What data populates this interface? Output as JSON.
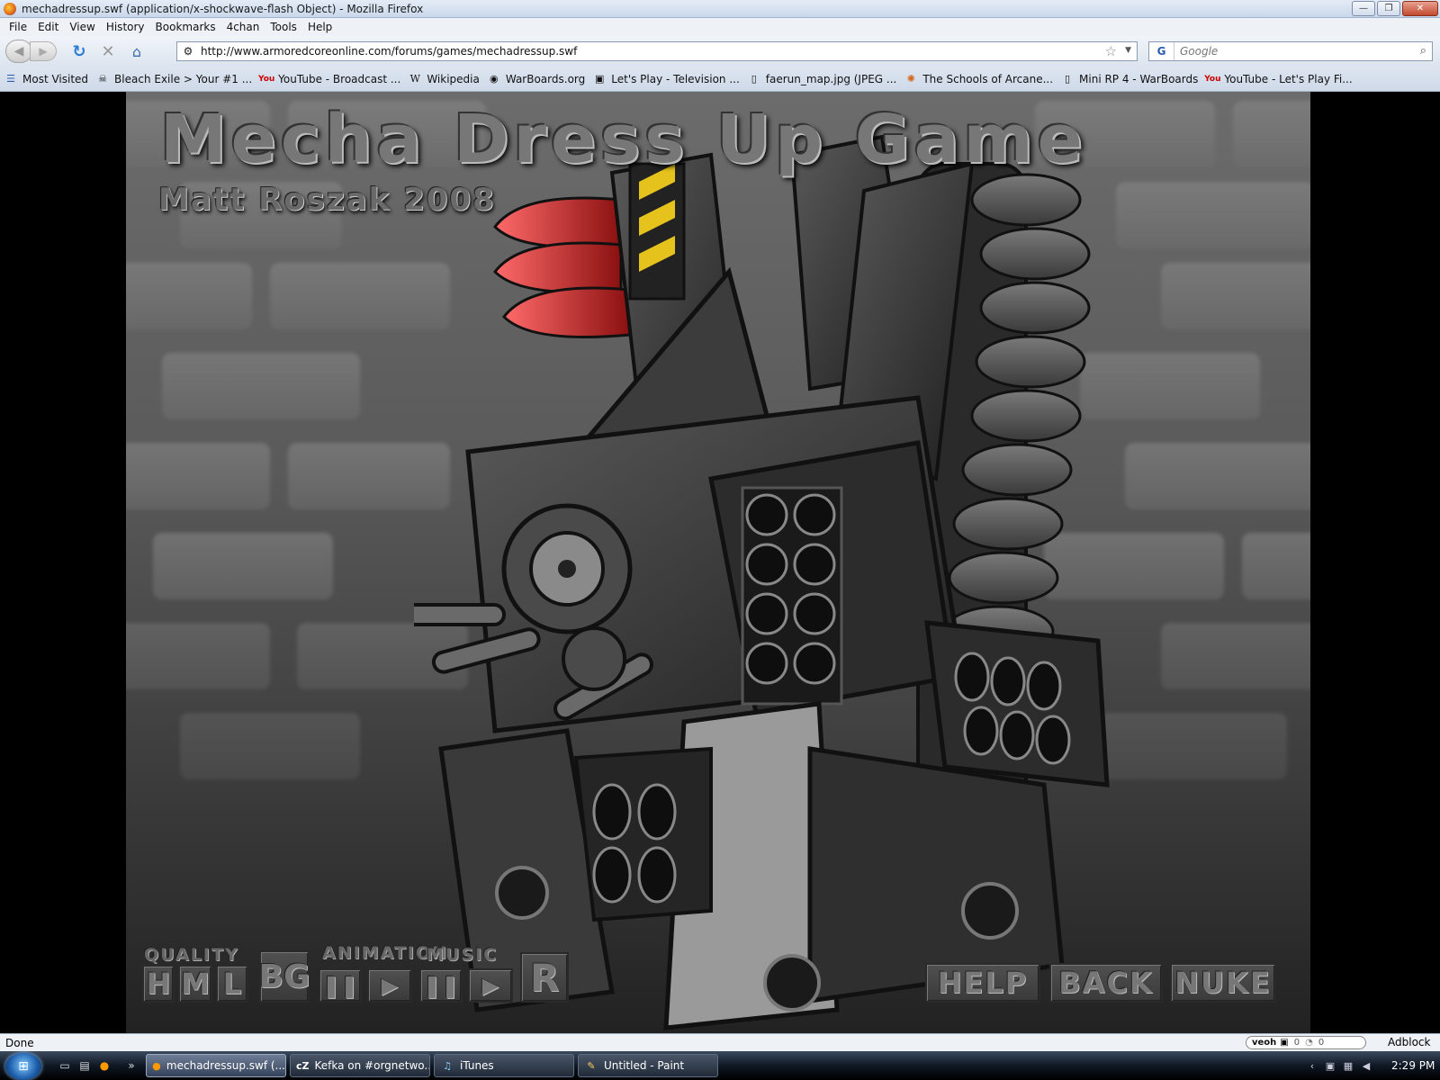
{
  "window": {
    "title": "mechadressup.swf (application/x-shockwave-flash Object) - Mozilla Firefox",
    "controls": {
      "minimize": "—",
      "restore": "❐",
      "close": "✕"
    }
  },
  "menu": [
    "File",
    "Edit",
    "View",
    "History",
    "Bookmarks",
    "4chan",
    "Tools",
    "Help"
  ],
  "nav": {
    "url": "http://www.armoredcoreonline.com/forums/games/mechadressup.swf",
    "search_placeholder": "Google",
    "search_engine_icon": "G"
  },
  "bookmarks": [
    {
      "label": "Most Visited",
      "icon": "most-visited-icon"
    },
    {
      "label": "Bleach Exile > Your #1 ...",
      "icon": "skull-icon"
    },
    {
      "label": "YouTube - Broadcast ...",
      "icon": "youtube-icon"
    },
    {
      "label": "Wikipedia",
      "icon": "wikipedia-icon"
    },
    {
      "label": "WarBoards.org",
      "icon": "warboards-icon"
    },
    {
      "label": "Let's Play - Television ...",
      "icon": "tv-icon"
    },
    {
      "label": "faerun_map.jpg (JPEG ...",
      "icon": "page-icon"
    },
    {
      "label": "The Schools of Arcane...",
      "icon": "arcane-icon"
    },
    {
      "label": "Mini RP 4 - WarBoards",
      "icon": "page-icon"
    },
    {
      "label": "YouTube - Let's Play Fi...",
      "icon": "youtube-icon"
    }
  ],
  "game": {
    "title": "Mecha Dress Up Game",
    "author": "Matt Roszak 2008",
    "labels": {
      "quality": "QUALITY",
      "animation": "ANIMATION",
      "music": "MUSIC"
    },
    "quality_buttons": [
      "H",
      "M",
      "L"
    ],
    "bg_button": "BG",
    "reset_button": "R",
    "action_buttons": [
      "HELP",
      "BACK",
      "NUKE"
    ]
  },
  "status": {
    "text": "Done",
    "veoh": "veoh",
    "veoh_count_1": "0",
    "veoh_count_2": "0",
    "adblock": "Adblock"
  },
  "taskbar": {
    "tasks": [
      {
        "label": "mechadressup.swf (...",
        "icon": "firefox-icon",
        "active": true
      },
      {
        "label": "Kefka on #orgnetwo...",
        "icon": "chatzilla-icon",
        "active": false
      },
      {
        "label": "iTunes",
        "icon": "itunes-icon",
        "active": false
      },
      {
        "label": "Untitled - Paint",
        "icon": "paint-icon",
        "active": false
      }
    ],
    "clock": "2:29 PM"
  }
}
